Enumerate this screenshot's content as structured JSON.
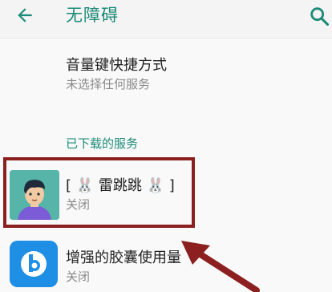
{
  "header": {
    "back_icon": "arrow-left-icon",
    "title": "无障碍",
    "search_icon": "search-icon"
  },
  "volume_shortcut": {
    "title": "音量键快捷方式",
    "subtitle": "未选择任何服务"
  },
  "downloaded_services": {
    "header": "已下载的服务",
    "items": [
      {
        "title": "[ 🐰 雷跳跳 🐰 ]",
        "status": "关闭",
        "icon": "cartoon-avatar"
      },
      {
        "title": "增强的胶囊使用量",
        "status": "关闭",
        "icon": "bixby-b-icon"
      }
    ]
  },
  "colors": {
    "accent": "#1b8a78",
    "annotation": "#8c1f1f"
  }
}
